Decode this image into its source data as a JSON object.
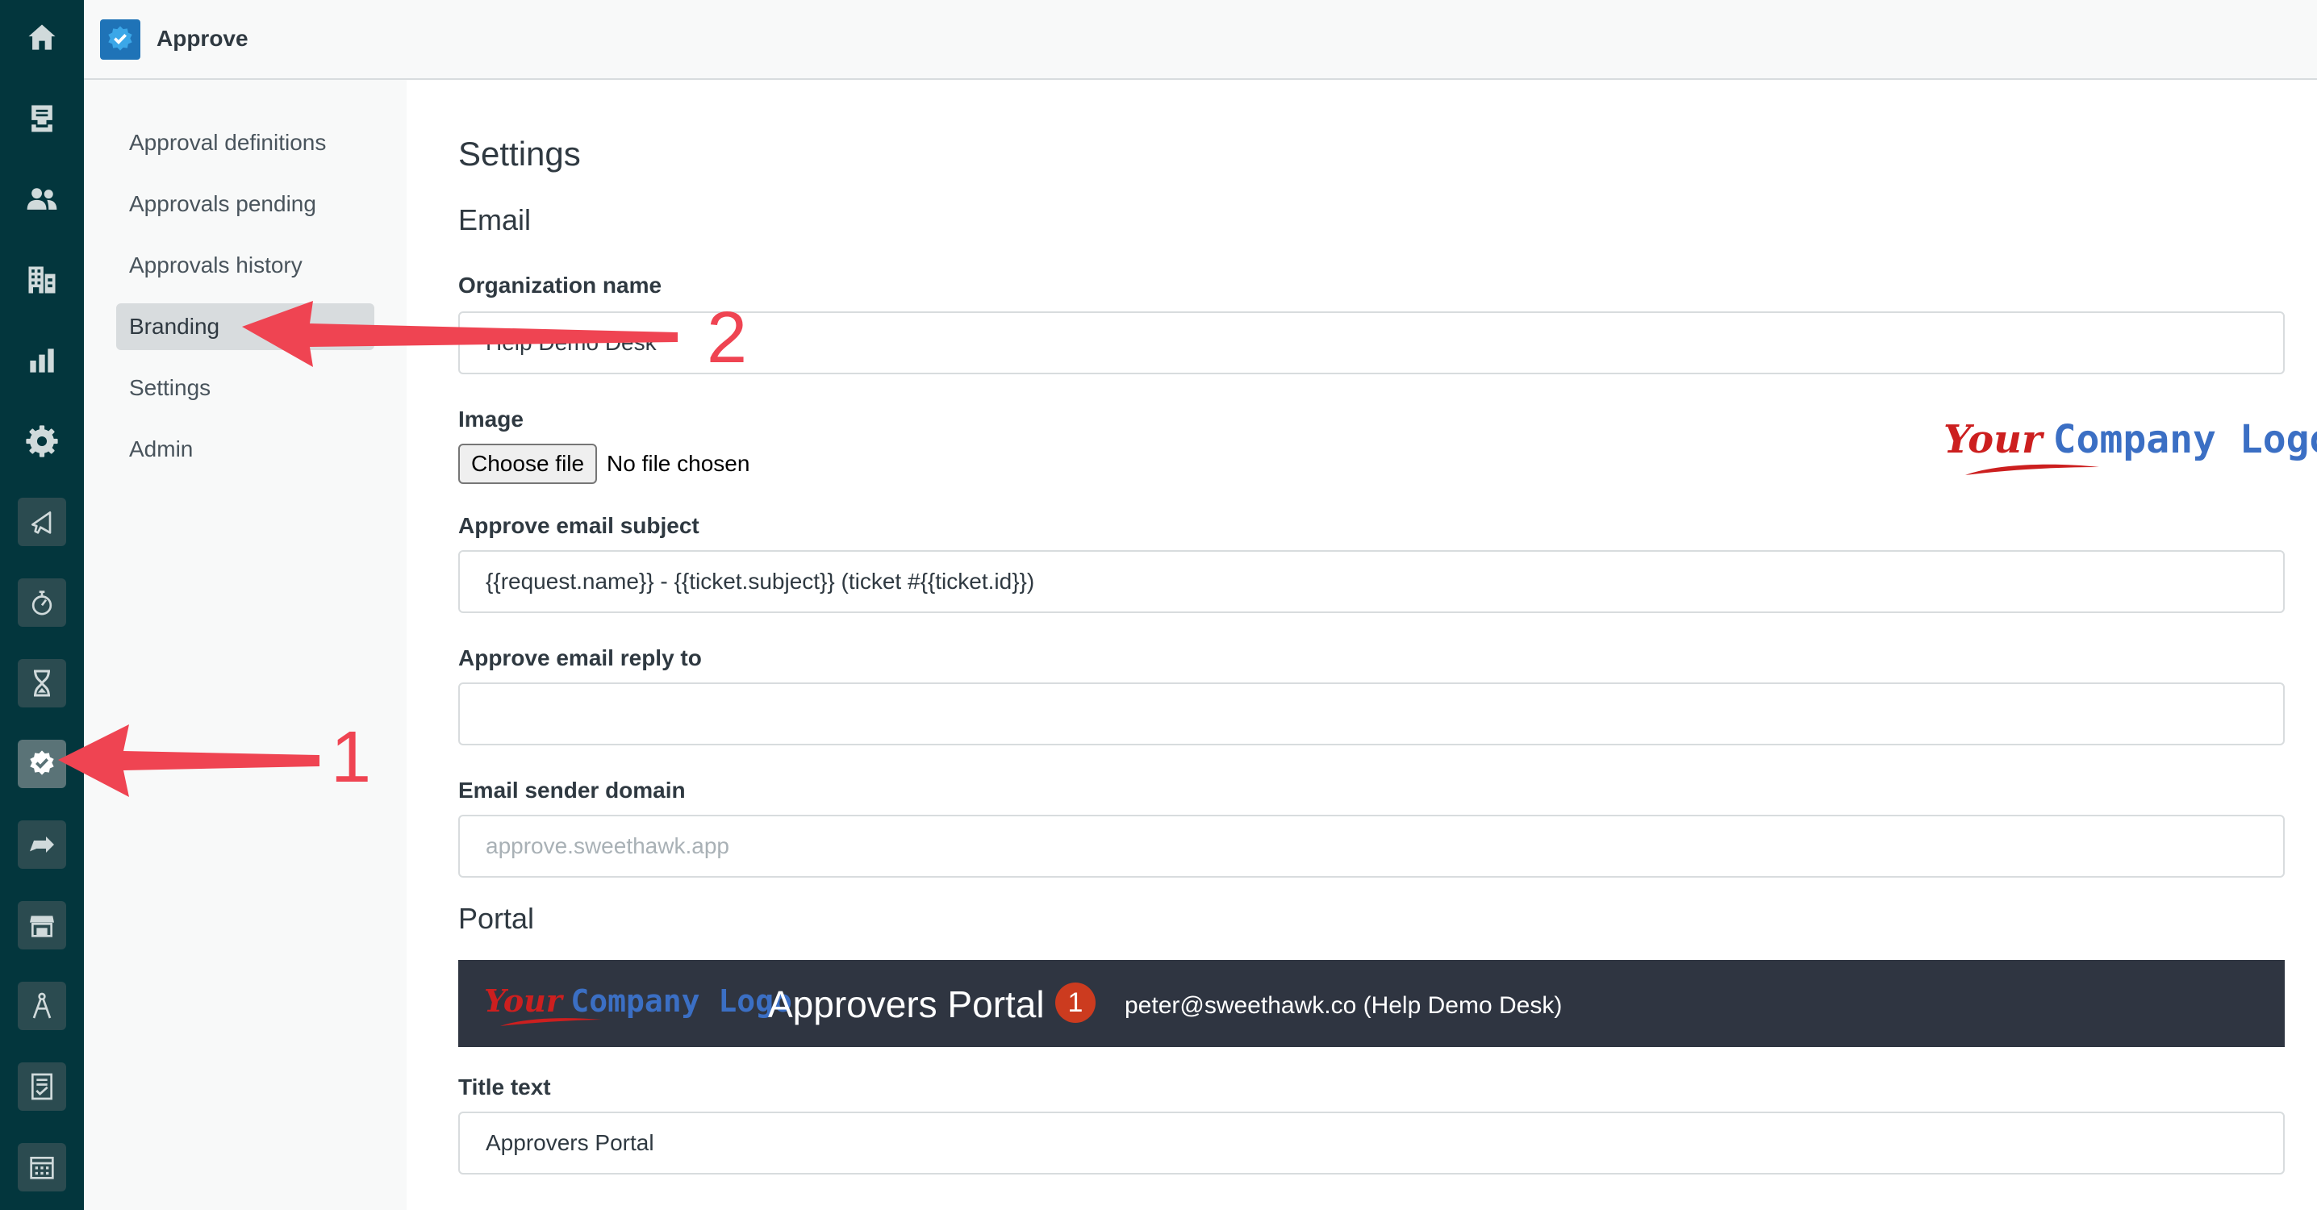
{
  "header": {
    "app_title": "Approve"
  },
  "rail": {
    "icons": [
      "home-icon",
      "tickets-icon",
      "users-icon",
      "organizations-icon",
      "reporting-icon",
      "admin-gear-icon",
      "app-megaphone-icon",
      "app-gauge-icon",
      "app-hourglass-icon",
      "app-approve-icon",
      "app-arrow-icon",
      "app-store-icon",
      "app-compass-icon",
      "app-checklist-icon",
      "app-calendar-icon"
    ],
    "active": "app-approve-icon"
  },
  "subnav": {
    "items": [
      {
        "label": "Approval definitions"
      },
      {
        "label": "Approvals pending"
      },
      {
        "label": "Approvals history"
      },
      {
        "label": "Branding"
      },
      {
        "label": "Settings"
      },
      {
        "label": "Admin"
      }
    ],
    "selected": "Branding"
  },
  "main": {
    "title": "Settings",
    "email_section": "Email",
    "org_name_label": "Organization name",
    "org_name_value": "Help Demo Desk",
    "image_label": "Image",
    "choose_file": "Choose file",
    "file_status": "No file chosen",
    "logo_your": "Your",
    "logo_rest": "Company Logo",
    "subject_label": "Approve email subject",
    "subject_value": "{{request.name}} - {{ticket.subject}} (ticket #{{ticket.id}})",
    "reply_label": "Approve email reply to",
    "reply_value": "",
    "sender_label": "Email sender domain",
    "sender_placeholder": "approve.sweethawk.app",
    "portal_section": "Portal",
    "portal": {
      "title": "Approvers Portal",
      "badge": "1",
      "user": "peter@sweethawk.co (Help Demo Desk)"
    },
    "title_text_label": "Title text",
    "title_text_value": "Approvers Portal"
  },
  "annotations": {
    "arrow1": "1",
    "arrow2": "2",
    "color": "#ef4452"
  }
}
